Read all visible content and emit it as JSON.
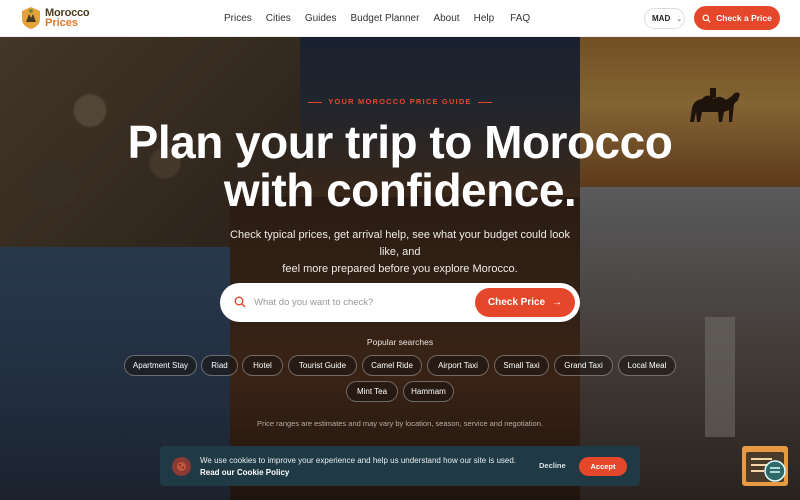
{
  "brand": {
    "line1": "Morocco",
    "line2": "Prices"
  },
  "nav": [
    "Prices",
    "Cities",
    "Guides",
    "Budget Planner",
    "About",
    "Help",
    "FAQ"
  ],
  "currency": "MAD",
  "header_cta": "Check a Price",
  "hero": {
    "eyebrow": "YOUR MOROCCO PRICE GUIDE",
    "title_line1": "Plan your trip to Morocco",
    "title_line2": "with confidence.",
    "subtitle_line1": "Check typical prices, get arrival help, see what your budget could look like, and",
    "subtitle_line2": "feel more prepared before you explore Morocco."
  },
  "search": {
    "placeholder": "What do you want to check?",
    "button": "Check Price"
  },
  "popular": {
    "label": "Popular searches",
    "chips": [
      "Apartment Stay",
      "Riad",
      "Hotel",
      "Tourist Guide",
      "Camel Ride",
      "Airport Taxi",
      "Small Taxi",
      "Grand Taxi",
      "Local Meal",
      "Mint Tea",
      "Hammam"
    ]
  },
  "disclaimer": "Price ranges are estimates and may vary by location, season, service and negotiation.",
  "cookie": {
    "text": "We use cookies to improve your experience and help us understand how our site is used.",
    "link": "Read our Cookie Policy",
    "decline": "Decline",
    "accept": "Accept"
  },
  "colors": {
    "accent": "#e5472b",
    "cookie_bg": "#1f3a44",
    "header_bg": "#ffffff"
  },
  "icons": [
    "logo-icon",
    "chevron-down-icon",
    "search-icon",
    "arrow-right-icon",
    "cookie-icon",
    "widget-icon"
  ]
}
